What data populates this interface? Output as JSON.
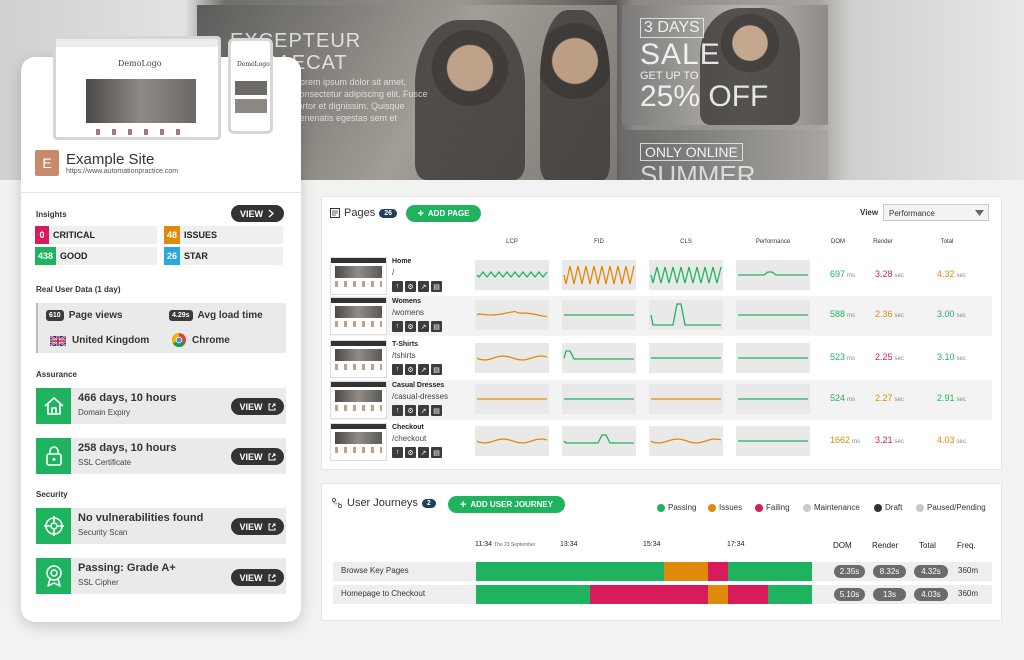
{
  "hero": {
    "headline": "EXCEPTEUR\nOCCAECAT",
    "body": "Lorem ipsum dolor sit amet, consectetur adipiscing elit. Fusce tortor et dignissim. Quisque venenatis egestas sem et",
    "sale_badge": "3 DAYS",
    "sale_word": "SALE",
    "sale_sub": "GET UP TO",
    "sale_amount": "25% OFF",
    "online_badge": "ONLY ONLINE",
    "summer_word": "SUMMER"
  },
  "site": {
    "initial": "E",
    "name": "Example Site",
    "url": "https://www.automationpractice.com",
    "mock_logo": "DemoLogo"
  },
  "insights": {
    "title": "Insights",
    "view_label": "VIEW",
    "items": [
      {
        "count": "0",
        "label": "CRITICAL",
        "color": "#d81b5a"
      },
      {
        "count": "48",
        "label": "ISSUES",
        "color": "#e08a0c"
      },
      {
        "count": "438",
        "label": "GOOD",
        "color": "#1fb35f"
      },
      {
        "count": "26",
        "label": "STAR",
        "color": "#29a8e0"
      }
    ]
  },
  "rud": {
    "title": "Real User Data (1 day)",
    "page_views_count": "610",
    "page_views_label": "Page views",
    "load_time_value": "4.29s",
    "load_time_label": "Avg load time",
    "country": "United Kingdom",
    "browser": "Chrome"
  },
  "assurance": {
    "title": "Assurance",
    "items": [
      {
        "main": "466 days, 10 hours",
        "sub": "Domain Expiry",
        "icon": "house-icon"
      },
      {
        "main": "258 days, 10 hours",
        "sub": "SSL Certificate",
        "icon": "lock-icon"
      }
    ]
  },
  "security": {
    "title": "Security",
    "items": [
      {
        "main": "No vulnerabilities found",
        "sub": "Security Scan",
        "icon": "crosshair-icon"
      },
      {
        "main": "Passing: Grade A+",
        "sub": "SSL Cipher",
        "icon": "award-icon"
      }
    ]
  },
  "view_label": "VIEW",
  "pages": {
    "title": "Pages",
    "count": "26",
    "add_label": "ADD PAGE",
    "view_label": "View",
    "view_select": "Performance",
    "columns": [
      "LCP",
      "FID",
      "CLS",
      "Performance",
      "DOM",
      "Render",
      "Total"
    ],
    "rows": [
      {
        "name": "Home",
        "path": "/",
        "dom": "697",
        "dom_color": "green",
        "render": "3.28",
        "render_color": "red",
        "total": "4.32",
        "total_color": "orange"
      },
      {
        "name": "Womens",
        "path": "/womens",
        "dom": "588",
        "dom_color": "green",
        "render": "2.36",
        "render_color": "orange",
        "total": "3.00",
        "total_color": "green"
      },
      {
        "name": "T-Shirts",
        "path": "/tshirts",
        "dom": "523",
        "dom_color": "green",
        "render": "2.25",
        "render_color": "red",
        "total": "3.10",
        "total_color": "green"
      },
      {
        "name": "Casual Dresses",
        "path": "/casual-dresses",
        "dom": "524",
        "dom_color": "green",
        "render": "2.27",
        "render_color": "orange",
        "total": "2.91",
        "total_color": "green"
      },
      {
        "name": "Checkout",
        "path": "/checkout",
        "dom": "1662",
        "dom_color": "orange",
        "render": "3.21",
        "render_color": "red",
        "total": "4.03",
        "total_color": "orange"
      }
    ],
    "ms": "ms",
    "sec": "sec"
  },
  "journeys": {
    "title": "User Journeys",
    "count": "2",
    "add_label": "ADD USER JOURNEY",
    "legend": [
      {
        "label": "Passing",
        "color": "#1fb35f"
      },
      {
        "label": "Issues",
        "color": "#e08a0c"
      },
      {
        "label": "Failing",
        "color": "#d81b5a"
      },
      {
        "label": "Maintenance",
        "color": "#c9c9c9"
      },
      {
        "label": "Draft",
        "color": "#333333"
      },
      {
        "label": "Paused/Pending",
        "color": "#c9c9c9"
      }
    ],
    "timeline": {
      "start": "11:34",
      "start_date": "Thu 23 September",
      "t2": "13:34",
      "t3": "15:34",
      "t4": "17:34"
    },
    "headers": {
      "dom": "DOM",
      "render": "Render",
      "total": "Total",
      "freq": "Freq."
    },
    "rows": [
      {
        "name": "Browse Key Pages",
        "dom": "2.35s",
        "render": "8.32s",
        "total": "4.32s",
        "freq": "360m",
        "segments": [
          {
            "status": "passing",
            "share": 0.56
          },
          {
            "status": "issues",
            "share": 0.13
          },
          {
            "status": "failing",
            "share": 0.06
          },
          {
            "status": "passing",
            "share": 0.25
          }
        ]
      },
      {
        "name": "Homepage to Checkout",
        "dom": "5.10s",
        "render": "13s",
        "total": "4.03s",
        "freq": "360m",
        "segments": [
          {
            "status": "passing",
            "share": 0.34
          },
          {
            "status": "failing",
            "share": 0.35
          },
          {
            "status": "issues",
            "share": 0.06
          },
          {
            "status": "failing",
            "share": 0.12
          },
          {
            "status": "passing",
            "share": 0.13
          }
        ]
      }
    ]
  },
  "colors": {
    "passing": "#1fb35f",
    "issues": "#e08a0c",
    "failing": "#d81b5a"
  }
}
